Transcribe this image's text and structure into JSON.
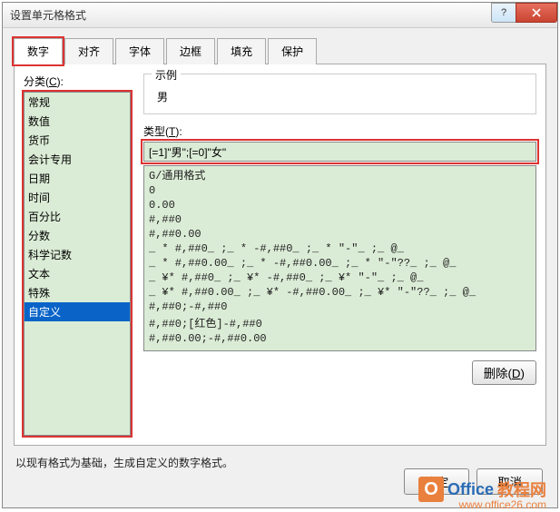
{
  "title": "设置单元格格式",
  "tabs": [
    {
      "label": "数字",
      "active": true,
      "highlighted": true
    },
    {
      "label": "对齐",
      "active": false,
      "highlighted": false
    },
    {
      "label": "字体",
      "active": false,
      "highlighted": false
    },
    {
      "label": "边框",
      "active": false,
      "highlighted": false
    },
    {
      "label": "填充",
      "active": false,
      "highlighted": false
    },
    {
      "label": "保护",
      "active": false,
      "highlighted": false
    }
  ],
  "category_label": "分类(C):",
  "categories": [
    {
      "label": "常规",
      "selected": false
    },
    {
      "label": "数值",
      "selected": false
    },
    {
      "label": "货币",
      "selected": false
    },
    {
      "label": "会计专用",
      "selected": false
    },
    {
      "label": "日期",
      "selected": false
    },
    {
      "label": "时间",
      "selected": false
    },
    {
      "label": "百分比",
      "selected": false
    },
    {
      "label": "分数",
      "selected": false
    },
    {
      "label": "科学记数",
      "selected": false
    },
    {
      "label": "文本",
      "selected": false
    },
    {
      "label": "特殊",
      "selected": false
    },
    {
      "label": "自定义",
      "selected": true
    }
  ],
  "sample_label": "示例",
  "sample_value": "男",
  "type_label": "类型(T):",
  "type_value": "[=1]\"男\";[=0]\"女\"",
  "type_list": [
    "G/通用格式",
    "0",
    "0.00",
    "#,##0",
    "#,##0.00",
    "_ * #,##0_ ;_ * -#,##0_ ;_ * \"-\"_ ;_ @_ ",
    "_ * #,##0.00_ ;_ * -#,##0.00_ ;_ * \"-\"??_ ;_ @_ ",
    "_ ¥* #,##0_ ;_ ¥* -#,##0_ ;_ ¥* \"-\"_ ;_ @_ ",
    "_ ¥* #,##0.00_ ;_ ¥* -#,##0.00_ ;_ ¥* \"-\"??_ ;_ @_ ",
    "#,##0;-#,##0",
    "#,##0;[红色]-#,##0",
    "#,##0.00;-#,##0.00"
  ],
  "delete_label": "删除(D)",
  "hint": "以现有格式为基础，生成自定义的数字格式。",
  "ok_label": "确定",
  "cancel_label": "取消",
  "watermark": {
    "brand1": "Office",
    "brand2": "教程网",
    "url": "www.office26.com"
  }
}
